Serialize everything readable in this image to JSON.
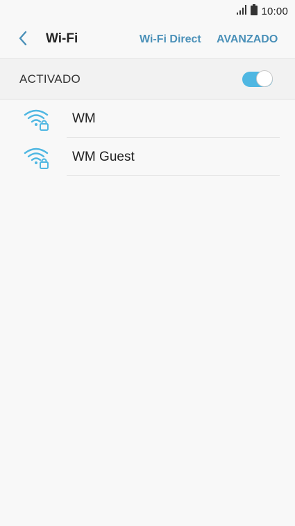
{
  "status_bar": {
    "time": "10:00",
    "icons": [
      "signal-icon",
      "battery-icon"
    ]
  },
  "header": {
    "back_icon": "chevron-left-icon",
    "title": "Wi-Fi",
    "actions": {
      "direct_label": "Wi-Fi Direct",
      "advanced_label": "AVANZADO"
    }
  },
  "master_switch": {
    "label": "ACTIVADO",
    "on": true
  },
  "networks": [
    {
      "name": "WM",
      "icon": "wifi-locked-icon"
    },
    {
      "name": "WM Guest",
      "icon": "wifi-locked-icon"
    }
  ],
  "colors": {
    "accent": "#4a90b8",
    "toggle_on": "#4fb7e2",
    "wifi_icon": "#4fb7e2",
    "background": "#f8f8f8"
  }
}
